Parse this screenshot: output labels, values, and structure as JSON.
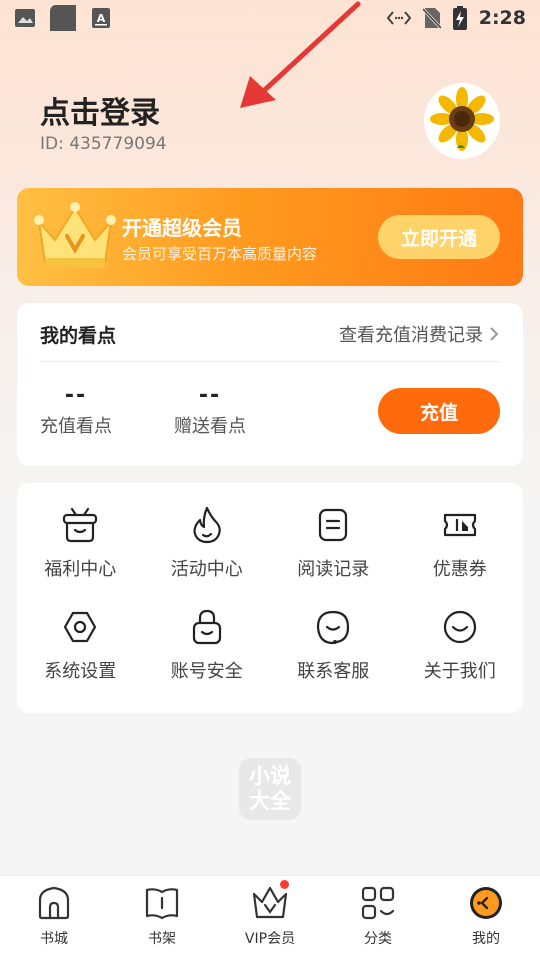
{
  "status_bar": {
    "time": "2:28",
    "icons": [
      "image-icon",
      "app-icon",
      "font-icon",
      "code-icon",
      "no-sim-icon",
      "battery-charging-icon"
    ]
  },
  "profile": {
    "login_text": "点击登录",
    "user_id": "ID: 435779094",
    "avatar": "sunflower-avatar"
  },
  "vip": {
    "title": "开通超级会员",
    "subtitle": "会员可享受百万本高质量内容",
    "button": "立即开通"
  },
  "points": {
    "title": "我的看点",
    "records_link": "查看充值消费记录",
    "recharge_value": "--",
    "recharge_label": "充值看点",
    "gift_value": "--",
    "gift_label": "赠送看点",
    "recharge_button": "充值"
  },
  "menu": {
    "items": [
      {
        "label": "福利中心",
        "icon": "welfare-icon"
      },
      {
        "label": "活动中心",
        "icon": "flame-icon"
      },
      {
        "label": "阅读记录",
        "icon": "reading-record-icon"
      },
      {
        "label": "优惠券",
        "icon": "coupon-icon"
      },
      {
        "label": "系统设置",
        "icon": "settings-icon"
      },
      {
        "label": "账号安全",
        "icon": "lock-icon"
      },
      {
        "label": "联系客服",
        "icon": "customer-service-icon"
      },
      {
        "label": "关于我们",
        "icon": "smile-icon"
      }
    ]
  },
  "watermark": {
    "line1": "小说",
    "line2": "大全"
  },
  "tabs": [
    {
      "label": "书城",
      "icon": "bookstore-icon"
    },
    {
      "label": "书架",
      "icon": "bookshelf-icon"
    },
    {
      "label": "VIP会员",
      "icon": "vip-crown-icon",
      "badge": true
    },
    {
      "label": "分类",
      "icon": "category-icon"
    },
    {
      "label": "我的",
      "icon": "profile-icon",
      "active": true
    }
  ],
  "colors": {
    "accent": "#ff6a0c",
    "vip_gradient_start": "#ffc043",
    "vip_gradient_end": "#ff7a14",
    "badge": "#ff3b30"
  }
}
